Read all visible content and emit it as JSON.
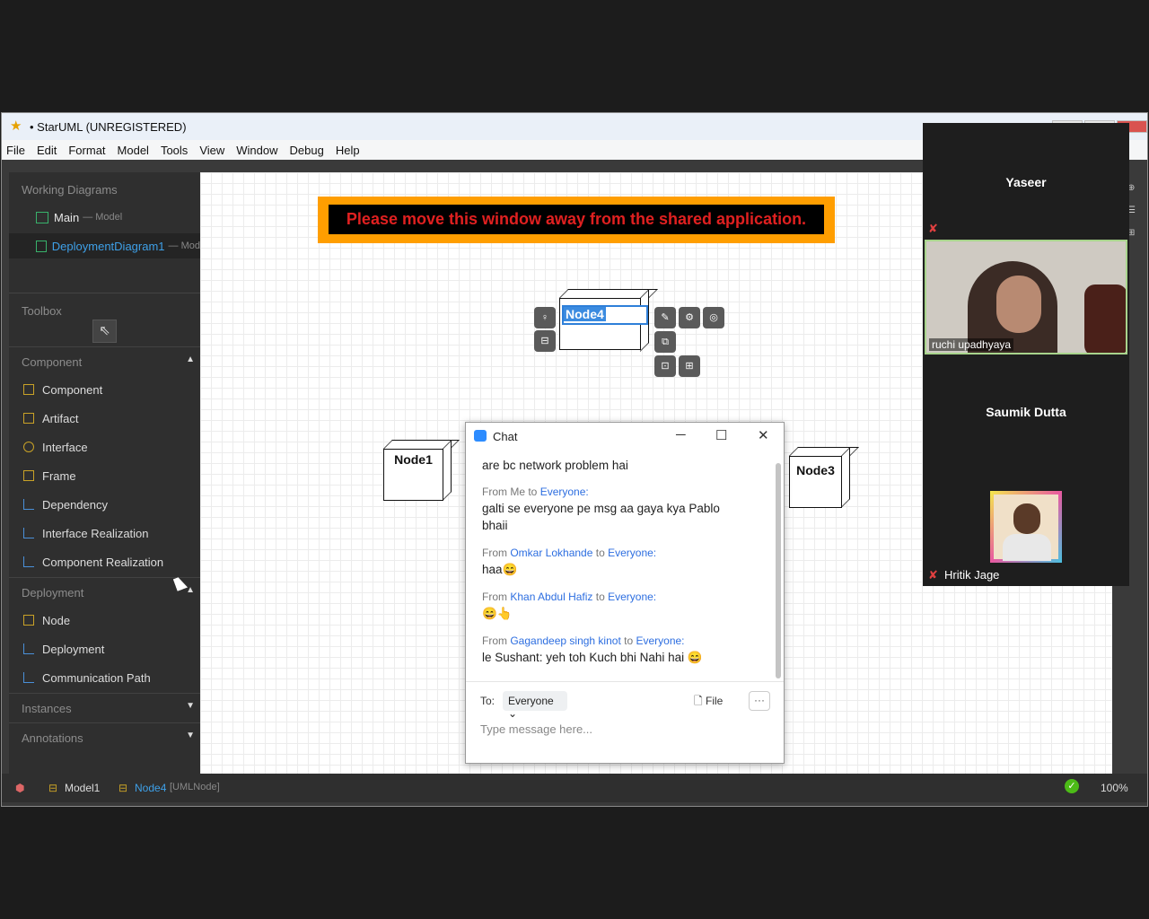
{
  "window": {
    "title": "• StarUML (UNREGISTERED)"
  },
  "menu": [
    "File",
    "Edit",
    "Format",
    "Model",
    "Tools",
    "View",
    "Window",
    "Debug",
    "Help"
  ],
  "sidebar": {
    "working_diagrams_title": "Working Diagrams",
    "diagrams": [
      {
        "name": "Main",
        "sub": "— Model"
      },
      {
        "name": "DeploymentDiagram1",
        "sub": "— Mod"
      }
    ],
    "toolbox_title": "Toolbox",
    "groups": {
      "component": {
        "label": "Component",
        "items": [
          "Component",
          "Artifact",
          "Interface",
          "Frame",
          "Dependency",
          "Interface Realization",
          "Component Realization"
        ]
      },
      "deployment": {
        "label": "Deployment",
        "items": [
          "Node",
          "Deployment",
          "Communication Path"
        ]
      },
      "instances": {
        "label": "Instances"
      },
      "annotations": {
        "label": "Annotations"
      }
    }
  },
  "canvas": {
    "banner": "Please move this window away from the shared application.",
    "nodes": {
      "node1": "Node1",
      "node3": "Node3",
      "node4": "Node4"
    }
  },
  "statusbar": {
    "model": "Model1",
    "selected": "Node4",
    "selected_type": "[UMLNode]",
    "zoom": "100%"
  },
  "participants": {
    "p1": "Yaseer",
    "p2": "ruchi upadhyaya",
    "p3": "Saumik Dutta",
    "p4": "Hritik Jage"
  },
  "chat": {
    "title": "Chat",
    "messages": [
      {
        "text": "are bc network problem hai"
      },
      {
        "from": "From Me to",
        "to": "Everyone:",
        "text": "galti se everyone pe msg aa gaya kya Pablo bhaii"
      },
      {
        "from": "From",
        "sender": "Omkar Lokhande",
        "mid": "to",
        "to": "Everyone:",
        "text": "haa😄"
      },
      {
        "from": "From",
        "sender": "Khan Abdul Hafiz",
        "mid": "to",
        "to": "Everyone:",
        "text": "😄👆"
      },
      {
        "from": "From",
        "sender": "Gagandeep singh kinot",
        "mid": "to",
        "to": "Everyone:",
        "text": "le Sushant: yeh toh Kuch bhi Nahi hai 😄"
      }
    ],
    "to_label": "To:",
    "to_value": "Everyone ⌄",
    "file_label": "File",
    "more_label": "···",
    "input_placeholder": "Type message here..."
  },
  "colors": {
    "banner_bg": "#ff9e00",
    "banner_text": "#e02020",
    "link": "#2d6ee0",
    "selection": "#3b8be0"
  }
}
